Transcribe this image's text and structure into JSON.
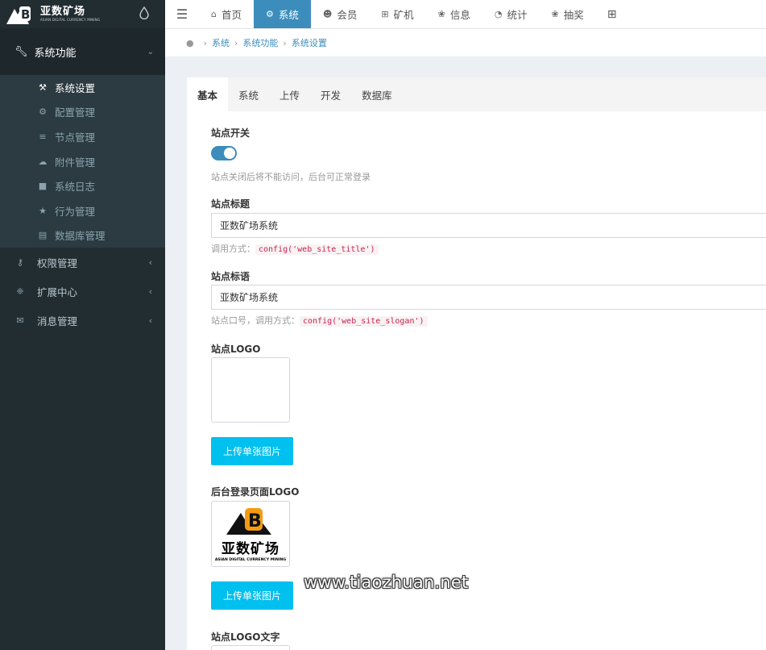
{
  "brand": {
    "title": "亚数矿场",
    "subtitle": "ASIAN DIGITAL CURRENCY MINING"
  },
  "sidebar": {
    "group": {
      "label": "系统功能",
      "icon": "wrench-icon"
    },
    "sub_items": [
      {
        "label": "系统设置",
        "icon": "wrench-icon",
        "active": true
      },
      {
        "label": "配置管理",
        "icon": "cogs-icon"
      },
      {
        "label": "节点管理",
        "icon": "list-icon"
      },
      {
        "label": "附件管理",
        "icon": "cloud-icon"
      },
      {
        "label": "系统日志",
        "icon": "book-icon"
      },
      {
        "label": "行为管理",
        "icon": "star-icon"
      },
      {
        "label": "数据库管理",
        "icon": "database-icon"
      }
    ],
    "items": [
      {
        "label": "权限管理",
        "icon": "key-icon"
      },
      {
        "label": "扩展中心",
        "icon": "cubes-icon"
      },
      {
        "label": "消息管理",
        "icon": "comments-icon"
      }
    ]
  },
  "topnav": {
    "tabs": [
      {
        "label": "首页",
        "icon": "home-icon"
      },
      {
        "label": "系统",
        "icon": "gear-icon",
        "active": true
      },
      {
        "label": "会员",
        "icon": "user-icon"
      },
      {
        "label": "矿机",
        "icon": "windows-icon"
      },
      {
        "label": "信息",
        "icon": "yelp-icon"
      },
      {
        "label": "统计",
        "icon": "pie-chart-icon"
      },
      {
        "label": "抽奖",
        "icon": "gift-icon"
      }
    ]
  },
  "breadcrumb": [
    "系统",
    "系统功能",
    "系统设置"
  ],
  "content_tabs": [
    "基本",
    "系统",
    "上传",
    "开发",
    "数据库"
  ],
  "form": {
    "site_switch": {
      "label": "站点开关",
      "on": true,
      "help": "站点关闭后将不能访问，后台可正常登录"
    },
    "site_title": {
      "label": "站点标题",
      "value": "亚数矿场系统",
      "help_prefix": "调用方式：",
      "code": "config('web_site_title')"
    },
    "site_slogan": {
      "label": "站点标语",
      "value": "亚数矿场系统",
      "help_prefix": "站点口号，调用方式：",
      "code": "config('web_site_slogan')"
    },
    "site_logo": {
      "label": "站点LOGO",
      "button": "上传单张图片"
    },
    "login_logo": {
      "label": "后台登录页面LOGO",
      "button": "上传单张图片",
      "logo_title": "亚数矿场",
      "logo_sub": "ASIAN DIGITAL CURRENCY MINING"
    },
    "logo_text": {
      "label": "站点LOGO文字"
    }
  },
  "watermark": "www.tiaozhuan.net",
  "colors": {
    "sidebar": "#222d32",
    "accent": "#3c8dbc",
    "upload": "#00c0ef",
    "code": "#c7254e"
  }
}
